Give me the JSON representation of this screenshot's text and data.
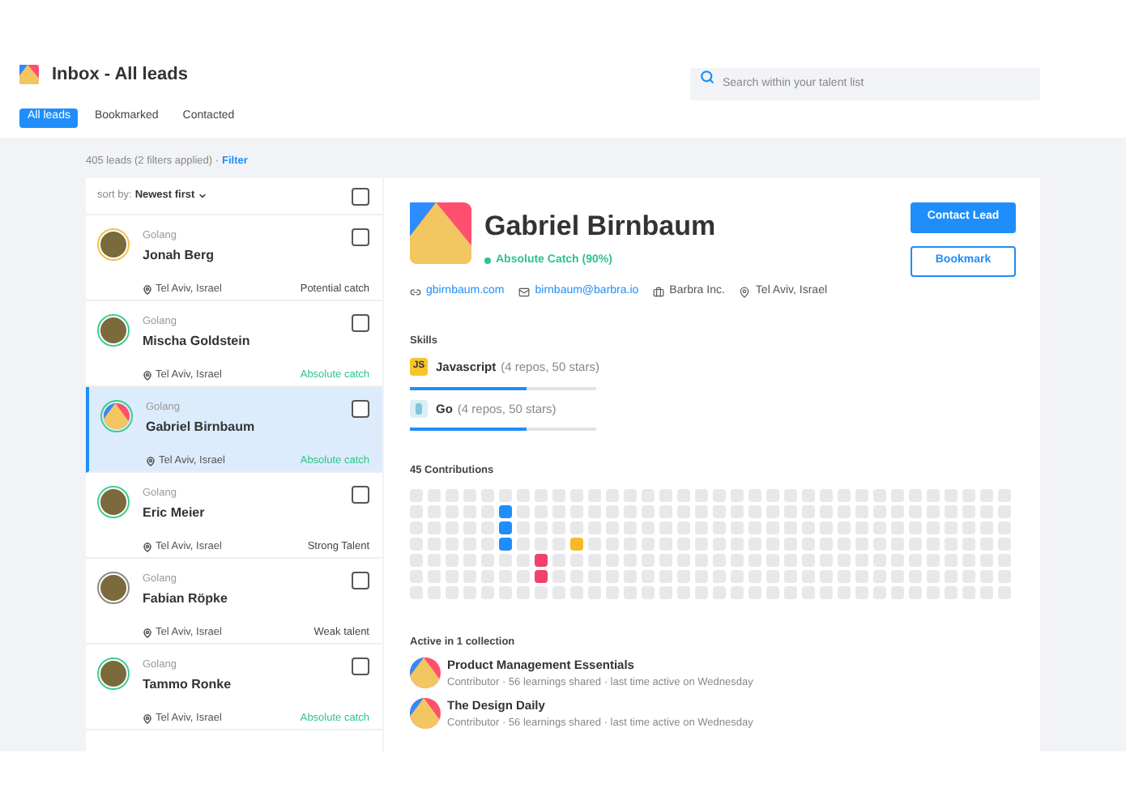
{
  "header": {
    "title": "Inbox - All leads",
    "tabs": [
      {
        "label": "All leads",
        "selected": true
      },
      {
        "label": "Bookmarked",
        "selected": false
      },
      {
        "label": "Contacted",
        "selected": false
      }
    ],
    "search": {
      "placeholder": "Search within your talent list"
    }
  },
  "summary": {
    "text": "405 leads (2 filters applied) ·",
    "link": "Filter"
  },
  "list": {
    "sort_label": "sort by:",
    "sort_value": "Newest first",
    "checked": false,
    "leads": [
      {
        "skill": "Golang",
        "name": "Jonah Berg",
        "location": "Tel Aviv, Israel",
        "status": {
          "text": "Potential catch",
          "kind": "neutral"
        },
        "avatar": {
          "kind": "photo",
          "color": "#f2c14e"
        },
        "selected": false,
        "checked": false
      },
      {
        "skill": "Golang",
        "name": "Mischa Goldstein",
        "location": "Tel Aviv, Israel",
        "status": {
          "text": "Absolute catch",
          "kind": "positive"
        },
        "avatar": {
          "kind": "photo",
          "color": "#3ccf8e"
        },
        "selected": false,
        "checked": false
      },
      {
        "skill": "Golang",
        "name": "Gabriel Birnbaum",
        "location": "Tel Aviv, Israel",
        "status": {
          "text": "Absolute catch",
          "kind": "positive"
        },
        "avatar": {
          "kind": "logo",
          "color": "#3ccf8e"
        },
        "selected": true,
        "checked": false
      },
      {
        "skill": "Golang",
        "name": "Eric Meier",
        "location": "Tel Aviv, Israel",
        "status": {
          "text": "Strong Talent",
          "kind": "neutral"
        },
        "avatar": {
          "kind": "photo",
          "color": "#3ccf8e"
        },
        "selected": false,
        "checked": false
      },
      {
        "skill": "Golang",
        "name": "Fabian Röpke",
        "location": "Tel Aviv, Israel",
        "status": {
          "text": "Weak talent",
          "kind": "neutral"
        },
        "avatar": {
          "kind": "photo",
          "color": "#8a8a8a"
        },
        "selected": false,
        "checked": false
      },
      {
        "skill": "Golang",
        "name": "Tammo Ronke",
        "location": "Tel Aviv, Israel",
        "status": {
          "text": "Absolute catch",
          "kind": "positive"
        },
        "avatar": {
          "kind": "photo",
          "color": "#3ccf8e"
        },
        "selected": false,
        "checked": false
      }
    ]
  },
  "detail": {
    "name": "Gabriel Birnbaum",
    "rating": "Absolute Catch (90%)",
    "buttons": {
      "primary": "Contact Lead",
      "secondary": "Bookmark"
    },
    "info": [
      {
        "kind": "website",
        "text": "gbirnbaum.com"
      },
      {
        "kind": "email",
        "text": "birnbaum@barbra.io"
      },
      {
        "kind": "company",
        "text": "Barbra Inc."
      },
      {
        "kind": "location",
        "text": "Tel Aviv, Israel"
      }
    ],
    "skills_title": "Skills",
    "skills": [
      {
        "kind": "js",
        "badge": "JS",
        "name": "Javascript",
        "stats": "(4 repos, 50 stars)",
        "level": 0.63
      },
      {
        "kind": "go",
        "name": "Go",
        "stats": "(4 repos, 50 stars)",
        "level": 0.63
      }
    ],
    "contributions_title": "45 Contributions",
    "collections_title": "Active in 1 collection",
    "collections": [
      {
        "name": "Product Management Essentials",
        "meta": "Contributor · 56 learnings shared · last time active on Wednesday"
      },
      {
        "name": "The Design Daily",
        "meta": "Contributor · 56 learnings shared · last time active on Wednesday"
      }
    ]
  }
}
